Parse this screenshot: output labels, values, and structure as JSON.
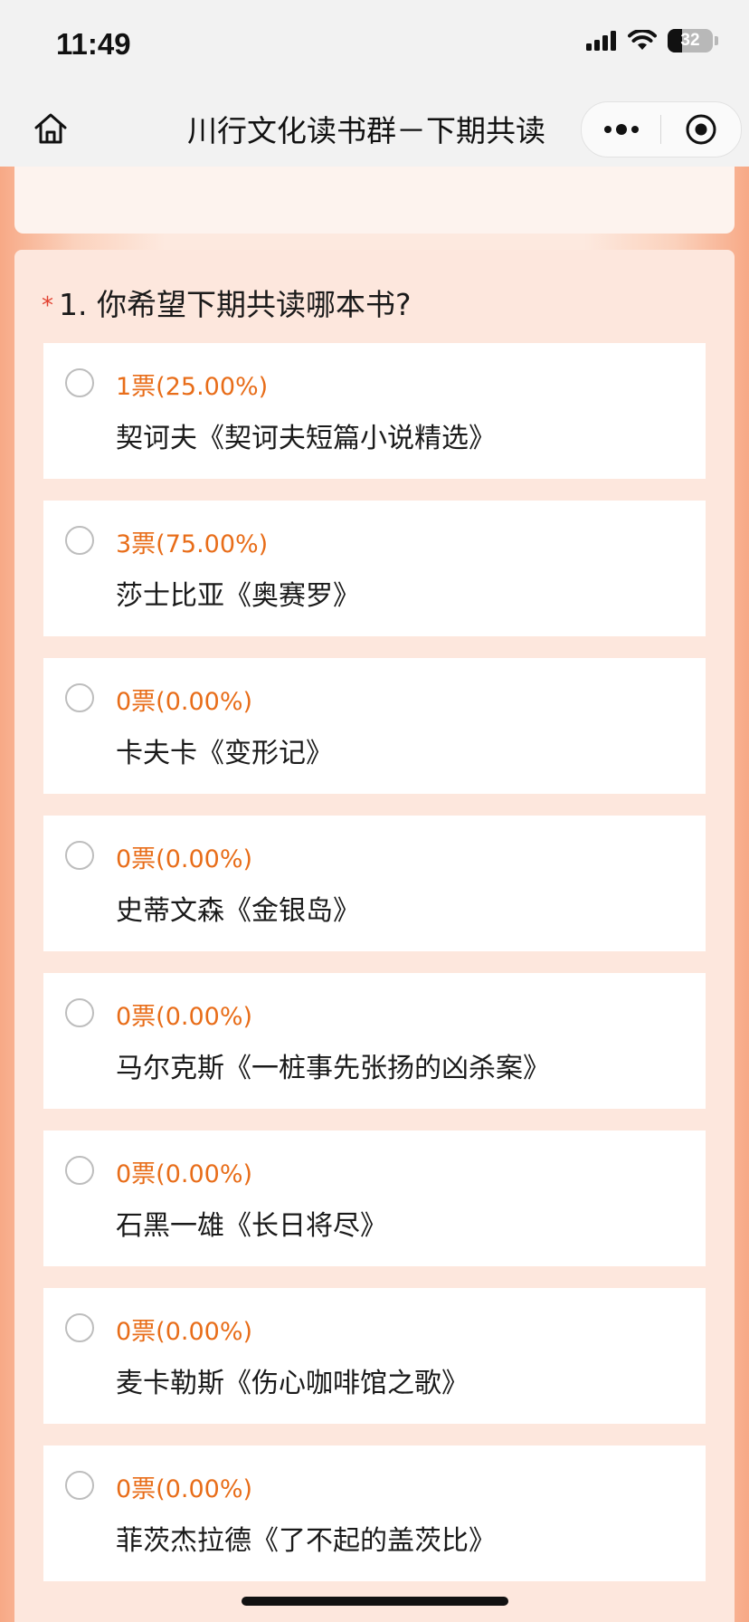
{
  "status_bar": {
    "time": "11:49",
    "battery": "32",
    "icons": [
      "signal-icon",
      "wifi-icon",
      "battery-icon"
    ]
  },
  "nav": {
    "title": "川行文化读书群－下期共读",
    "icons": [
      "home-icon",
      "more-icon",
      "close-miniprogram-icon"
    ]
  },
  "question": {
    "required_mark": "*",
    "title": "1. 你希望下期共读哪本书?",
    "options": [
      {
        "votes": "1票(25.00%)",
        "book": "契诃夫《契诃夫短篇小说精选》"
      },
      {
        "votes": "3票(75.00%)",
        "book": "莎士比亚《奥赛罗》"
      },
      {
        "votes": "0票(0.00%)",
        "book": "卡夫卡《变形记》"
      },
      {
        "votes": "0票(0.00%)",
        "book": "史蒂文森《金银岛》"
      },
      {
        "votes": "0票(0.00%)",
        "book": "马尔克斯《一桩事先张扬的凶杀案》"
      },
      {
        "votes": "0票(0.00%)",
        "book": "石黑一雄《长日将尽》"
      },
      {
        "votes": "0票(0.00%)",
        "book": "麦卡勒斯《伤心咖啡馆之歌》"
      },
      {
        "votes": "0票(0.00%)",
        "book": "菲茨杰拉德《了不起的盖茨比》"
      }
    ]
  },
  "colors": {
    "accent": "#e86d19",
    "required": "#e2412f",
    "background_edge": "#f7a986",
    "card": "#fde7dd"
  }
}
